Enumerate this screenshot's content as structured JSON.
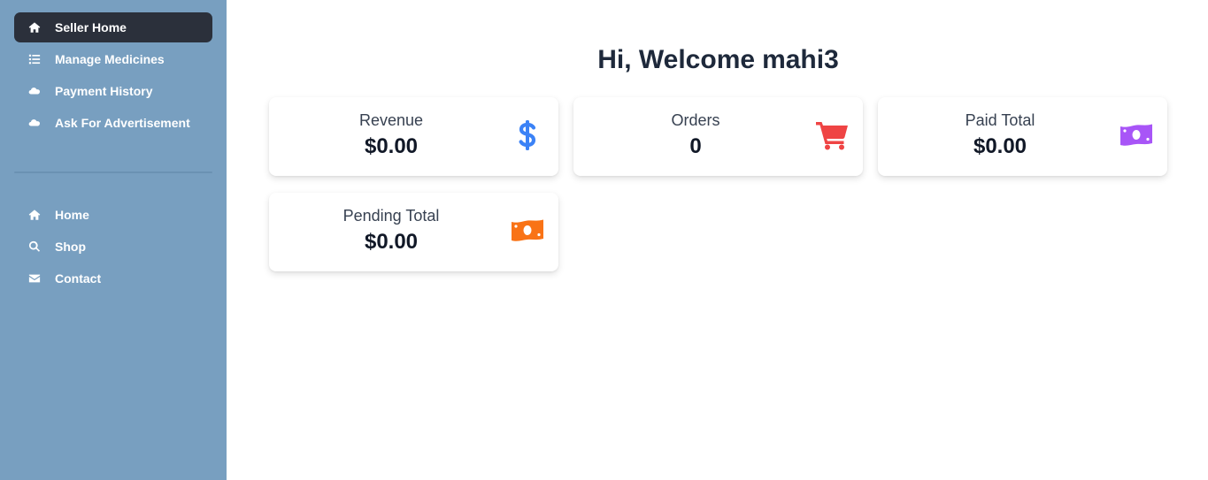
{
  "sidebar": {
    "top_items": [
      {
        "label": "Seller Home",
        "icon": "home-icon",
        "active": true
      },
      {
        "label": "Manage Medicines",
        "icon": "list-icon",
        "active": false
      },
      {
        "label": "Payment History",
        "icon": "cloud-money-icon",
        "active": false
      },
      {
        "label": "Ask For Advertisement",
        "icon": "cloud-money-icon",
        "active": false
      }
    ],
    "bottom_items": [
      {
        "label": "Home",
        "icon": "home-icon"
      },
      {
        "label": "Shop",
        "icon": "search-icon"
      },
      {
        "label": "Contact",
        "icon": "envelope-icon"
      }
    ],
    "background": "#789fc0",
    "active_background": "#2b303b"
  },
  "main": {
    "greeting": "Hi, Welcome",
    "username": "mahi3",
    "cards": [
      {
        "label": "Revenue",
        "value": "$0.00",
        "icon": "dollar-icon",
        "color": "#3b82f6"
      },
      {
        "label": "Orders",
        "value": "0",
        "icon": "cart-icon",
        "color": "#ef4444"
      },
      {
        "label": "Paid Total",
        "value": "$0.00",
        "icon": "money-bill-icon",
        "color": "#a855f7"
      },
      {
        "label": "Pending Total",
        "value": "$0.00",
        "icon": "money-bill-icon",
        "color": "#f97316"
      }
    ]
  }
}
